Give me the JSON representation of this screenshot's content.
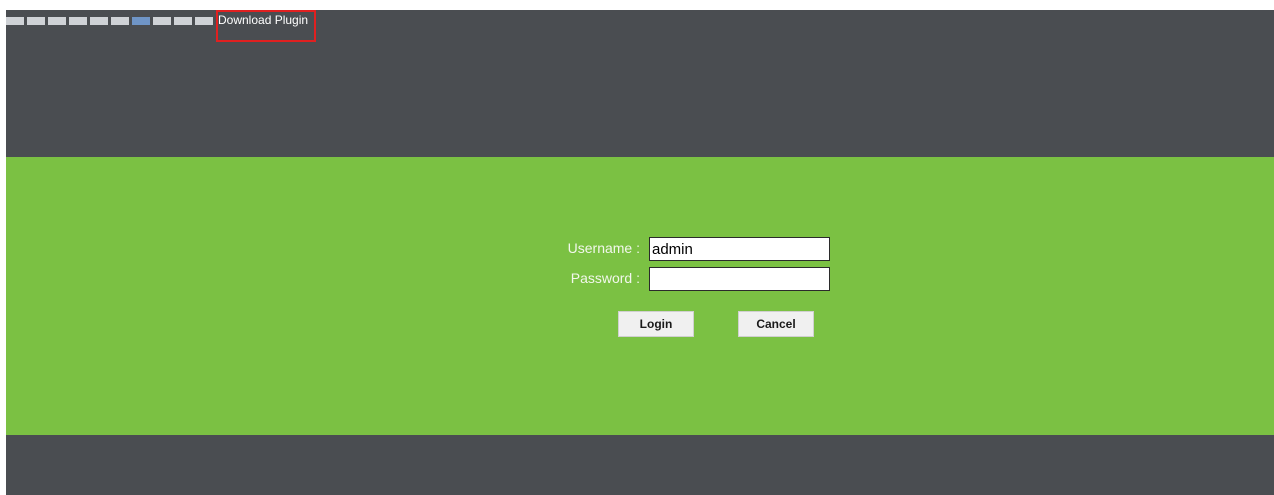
{
  "header": {
    "language_flags": [
      {
        "name": "language-flag-1",
        "active": false
      },
      {
        "name": "language-flag-2",
        "active": false
      },
      {
        "name": "language-flag-3",
        "active": false
      },
      {
        "name": "language-flag-4",
        "active": false
      },
      {
        "name": "language-flag-5",
        "active": false
      },
      {
        "name": "language-flag-6",
        "active": false
      },
      {
        "name": "language-flag-7",
        "active": true
      },
      {
        "name": "language-flag-8",
        "active": false
      },
      {
        "name": "language-flag-9",
        "active": false
      },
      {
        "name": "language-flag-10",
        "active": false
      }
    ],
    "download_label": "Download Plugin"
  },
  "login": {
    "username_label": "Username :",
    "username_value": "admin",
    "password_label": "Password :",
    "password_value": "",
    "login_label": "Login",
    "cancel_label": "Cancel"
  },
  "colors": {
    "header_bg": "#4a4d51",
    "login_bg": "#7bc143",
    "highlight": "#e02020",
    "flag_active": "#6f95c7",
    "flag_inactive": "#cfd2d6"
  }
}
